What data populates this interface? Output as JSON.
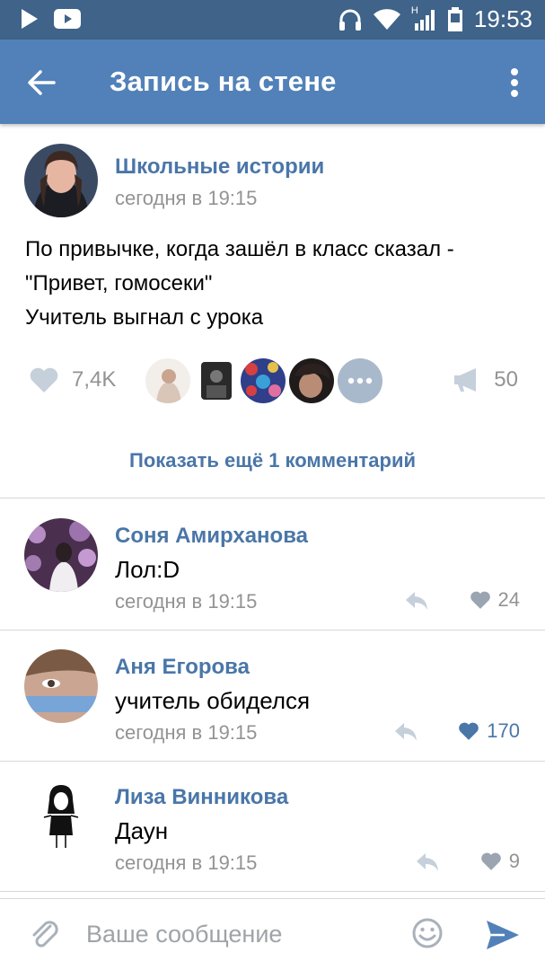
{
  "status_bar": {
    "time": "19:53",
    "icons": [
      "play-store-icon",
      "youtube-icon",
      "headphones-icon",
      "wifi-icon",
      "signal-icon",
      "battery-icon"
    ],
    "signal_label": "H"
  },
  "app_bar": {
    "title": "Запись на стене",
    "back_icon": "arrow-left-icon",
    "menu_icon": "more-vertical-icon"
  },
  "post": {
    "author": "Школьные истории",
    "time": "сегодня в 19:15",
    "text_lines": [
      "По привычке, когда зашёл в класс сказал -",
      "\"Привет, гомосеки\"",
      "Учитель выгнал с урока"
    ],
    "likes": "7,4K",
    "reposts": "50"
  },
  "show_more": "Показать ещё 1 комментарий",
  "comments": [
    {
      "name": "Соня Амирханова",
      "text": "Лол:D",
      "time": "сегодня в 19:15",
      "likes": "24",
      "liked": false
    },
    {
      "name": "Аня Егорова",
      "text": "учитель обиделся",
      "time": "сегодня в 19:15",
      "likes": "170",
      "liked": true
    },
    {
      "name": "Лиза Винникова",
      "text": "Даун",
      "time": "сегодня в 19:15",
      "likes": "9",
      "liked": false
    }
  ],
  "composer": {
    "placeholder": "Ваше сообщение"
  },
  "colors": {
    "status_bar": "#3f6389",
    "app_bar": "#5181b8",
    "link": "#4a76a8",
    "muted": "#939393",
    "liked": "#4a76a8"
  }
}
